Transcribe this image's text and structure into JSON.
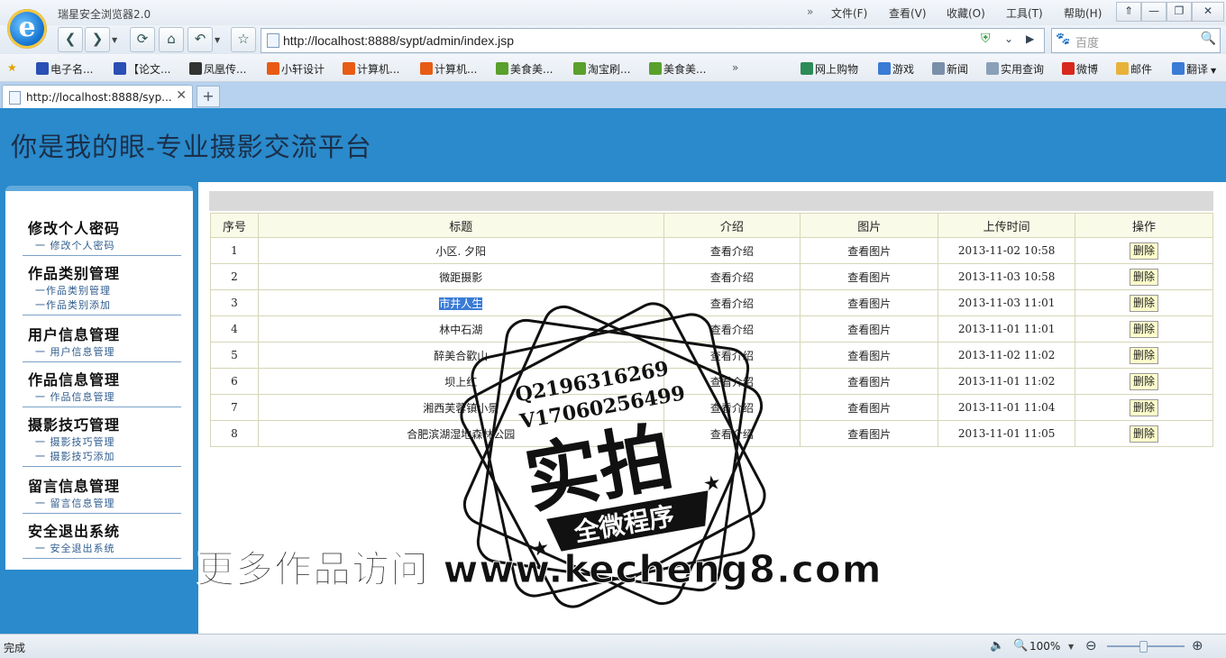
{
  "browser": {
    "title": "瑞星安全浏览器2.0",
    "menus": [
      "文件(F)",
      "查看(V)",
      "收藏(O)",
      "工具(T)",
      "帮助(H)"
    ],
    "url": "http://localhost:8888/sypt/admin/index.jsp",
    "search_placeholder": "百度",
    "bookmarks": [
      "电子名...",
      "【论文...",
      "凤凰传...",
      "小轩设计",
      "计算机...",
      "计算机...",
      "美食美...",
      "淘宝刷...",
      "美食美..."
    ],
    "bookmarks_right": [
      "网上购物",
      "游戏",
      "新闻",
      "实用查询",
      "微博",
      "邮件",
      "翻译"
    ],
    "tab_title": "http://localhost:8888/syp...",
    "status": "完成",
    "zoom": "100%"
  },
  "page": {
    "site_title": "你是我的眼-专业摄影交流平台",
    "sidebar": [
      {
        "head": "修改个人密码",
        "items": [
          "一 修改个人密码"
        ]
      },
      {
        "head": "作品类别管理",
        "items": [
          "一作品类别管理",
          "一作品类别添加"
        ]
      },
      {
        "head": "用户信息管理",
        "items": [
          "一 用户信息管理"
        ]
      },
      {
        "head": "作品信息管理",
        "items": [
          "一 作品信息管理"
        ]
      },
      {
        "head": "摄影技巧管理",
        "items": [
          "一 摄影技巧管理",
          "一 摄影技巧添加"
        ]
      },
      {
        "head": "留言信息管理",
        "items": [
          "一 留言信息管理"
        ]
      },
      {
        "head": "安全退出系统",
        "items": [
          "一 安全退出系统"
        ]
      }
    ],
    "table": {
      "headers": [
        "序号",
        "标题",
        "介绍",
        "图片",
        "上传时间",
        "操作"
      ],
      "rows": [
        {
          "no": "1",
          "title": "小区. 夕阳",
          "intro": "查看介绍",
          "image": "查看图片",
          "time": "2013-11-02 10:58",
          "action": "删除"
        },
        {
          "no": "2",
          "title": "微距摄影",
          "intro": "查看介绍",
          "image": "查看图片",
          "time": "2013-11-03 10:58",
          "action": "删除"
        },
        {
          "no": "3",
          "title": "市井人生",
          "intro": "查看介绍",
          "image": "查看图片",
          "time": "2013-11-03 11:01",
          "action": "删除"
        },
        {
          "no": "4",
          "title": "林中石湖",
          "intro": "查看介绍",
          "image": "查看图片",
          "time": "2013-11-01 11:01",
          "action": "删除"
        },
        {
          "no": "5",
          "title": "醉美合歡山",
          "intro": "查看介绍",
          "image": "查看图片",
          "time": "2013-11-02 11:02",
          "action": "删除"
        },
        {
          "no": "6",
          "title": "坝上红",
          "intro": "查看介绍",
          "image": "查看图片",
          "time": "2013-11-01 11:02",
          "action": "删除"
        },
        {
          "no": "7",
          "title": "湘西芙蓉镇小景",
          "intro": "查看介绍",
          "image": "查看图片",
          "time": "2013-11-01 11:04",
          "action": "删除"
        },
        {
          "no": "8",
          "title": "合肥滨湖湿地森林公园",
          "intro": "查看介绍",
          "image": "查看图片",
          "time": "2013-11-01 11:05",
          "action": "删除"
        }
      ]
    }
  },
  "overlay": {
    "stamp_line1": "Q2196316269",
    "stamp_line2": "V17060256499",
    "stamp_main": "实拍",
    "stamp_banner": "全微程序",
    "watermark": "更多作品访问 www.kecheng8.com"
  },
  "colors": {
    "header_blue": "#2a8acb",
    "row_select": "#3a7bd5",
    "table_head": "#fafae8"
  }
}
